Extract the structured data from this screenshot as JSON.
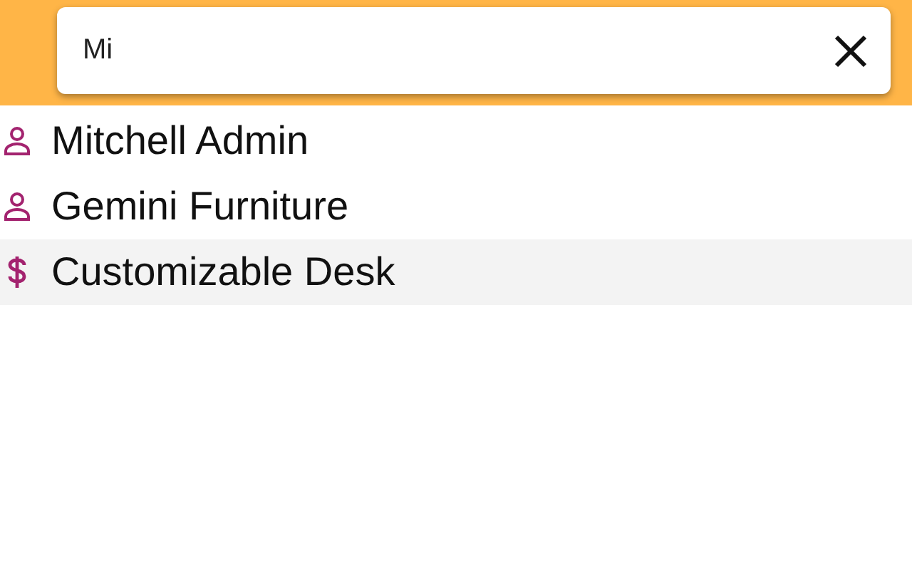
{
  "search": {
    "value": "Mi"
  },
  "results": [
    {
      "kind": "person",
      "label": "Mitchell Admin",
      "selected": false
    },
    {
      "kind": "person",
      "label": "Gemini Furniture",
      "selected": false
    },
    {
      "kind": "product",
      "label": "Customizable Desk",
      "selected": true
    }
  ]
}
